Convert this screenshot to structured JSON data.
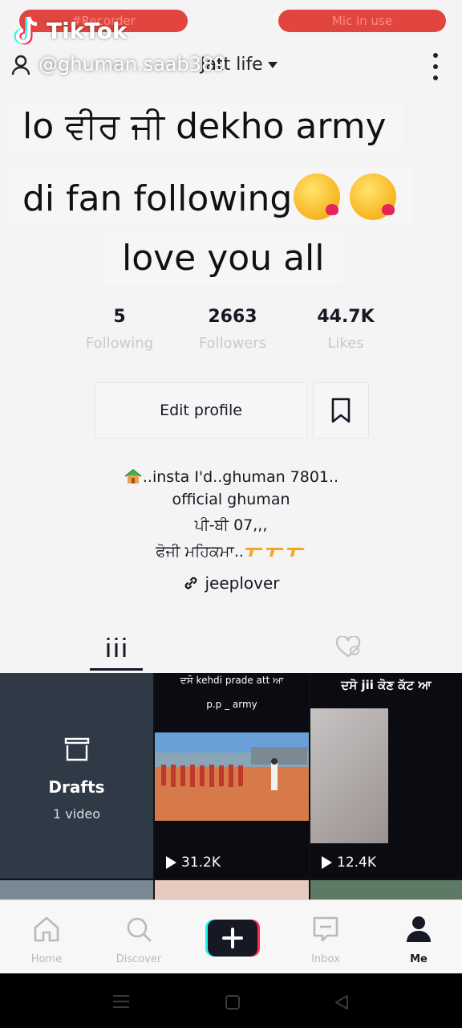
{
  "recording": {
    "recorder_label": "#Recorder",
    "mic_label": "Mic in use"
  },
  "watermark": {
    "brand": "TikTok",
    "handle": "@ghuman.saab389"
  },
  "topbar": {
    "title": "Jatt life"
  },
  "caption": {
    "line1": "lo ਵੀਰ ਜੀ dekho army",
    "line2": "di fan following",
    "line3": "love you all"
  },
  "stats": [
    {
      "value": "5",
      "label": "Following"
    },
    {
      "value": "2663",
      "label": "Followers"
    },
    {
      "value": "44.7K",
      "label": "Likes"
    }
  ],
  "buttons": {
    "edit_profile": "Edit profile"
  },
  "bio": {
    "line1": "..insta I'd..ghuman 7801..",
    "line2": "official ghuman",
    "line3": "ਪੀ-ਬੀ 07,,,",
    "line4": "ਫੋਜੀ ਮਹਿਕਮਾ..",
    "link": "jeeplover"
  },
  "grid": {
    "drafts_title": "Drafts",
    "drafts_count": "1 video",
    "videos": [
      {
        "caption": "ਦਸੋ kehdi prade att ਆ",
        "subcaption": "p.p _ army",
        "views": "31.2K"
      },
      {
        "caption": "ਦਸੋ jii ਕੋਣ ਕੱਟ ਆ",
        "views": "12.4K"
      }
    ]
  },
  "nav": [
    {
      "label": "Home",
      "icon": "home-icon"
    },
    {
      "label": "Discover",
      "icon": "search-icon"
    },
    {
      "label": "",
      "icon": "plus-icon"
    },
    {
      "label": "Inbox",
      "icon": "inbox-icon"
    },
    {
      "label": "Me",
      "icon": "person-icon"
    }
  ]
}
